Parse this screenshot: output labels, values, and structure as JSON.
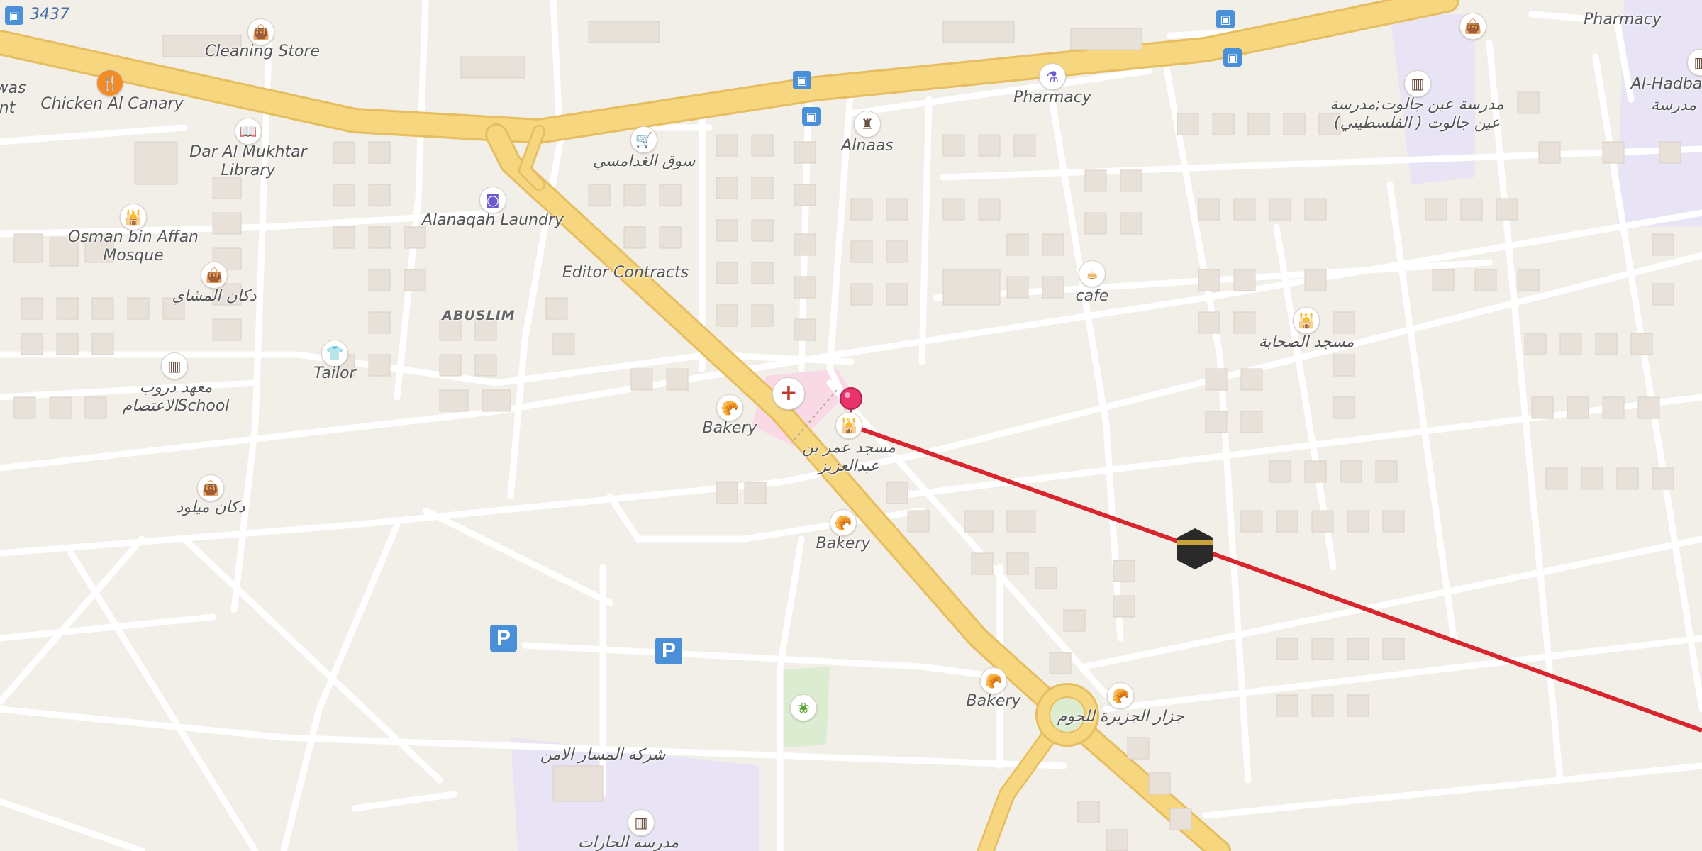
{
  "map": {
    "background": "#f2efe9",
    "road_color": "#ffffff",
    "major_road_color": "#f6d67f",
    "major_road_edge": "#e6bd5f",
    "route_color": "#d9262e",
    "pin_color": "#e8336b",
    "hospital_area_color": "#f9d9e6",
    "school_area_color": "#e9e4f5",
    "park_area_color": "#dcecd0",
    "route_number": "3437",
    "labels": {
      "cleaning_store": "Cleaning Store",
      "chicken_al_canary": "Chicken Al Canary",
      "dar_al_mukhtar_library": "Dar Al Mukhtar Library",
      "osman_mosque": "Osman bin Affan Mosque",
      "dukan_almashai": "دكان المشاي",
      "tailor": "Tailor",
      "school_left": "معهد دروب الاعتصامSchool",
      "dukan_milood": "دكان ميلود",
      "alanaqah_laundry": "Alanaqah Laundry",
      "souq_alghadamsi": "سوق الغدامسي",
      "editor_contracts": "Editor Contracts",
      "abuslim": "ABUSLIM",
      "bakery_1": "Bakery",
      "mosque_omar": "مسجد عمر بن عبدالعزيز",
      "bakery_2": "Bakery",
      "bakery_3": "Bakery",
      "jazira_butcher": "جزار الجزيرة للحوم",
      "security_company": "شركة المسار الامن",
      "school_bottom": "مدرسة الحارات",
      "alnaas": "Alnaas",
      "pharmacy_1": "Pharmacy",
      "pharmacy_2": "Pharmacy",
      "school_ain_jalut": "مدرسة عين جالوت;مدرسة عين جالوت ( الفلسطيني)",
      "cafe": "cafe",
      "sahaba_mosque": "مسجد الصحابة",
      "al_hadba": "Al-Hadba",
      "al_hadba_ar": "مدرسة",
      "left_edge_1": "was",
      "left_edge_2": "nt"
    },
    "icons": [
      "bus-stop-icon",
      "shopping-bag-icon",
      "fork-knife-icon",
      "book-icon",
      "mosque-icon",
      "shirt-icon",
      "school-icon",
      "laundry-icon",
      "cart-icon",
      "bakery-icon",
      "hospital-icon",
      "pin-icon",
      "pharmacy-icon",
      "tower-icon",
      "cafe-icon",
      "kaaba-icon",
      "parking-icon",
      "butcher-icon",
      "garden-icon"
    ],
    "parking_letter": "P"
  }
}
